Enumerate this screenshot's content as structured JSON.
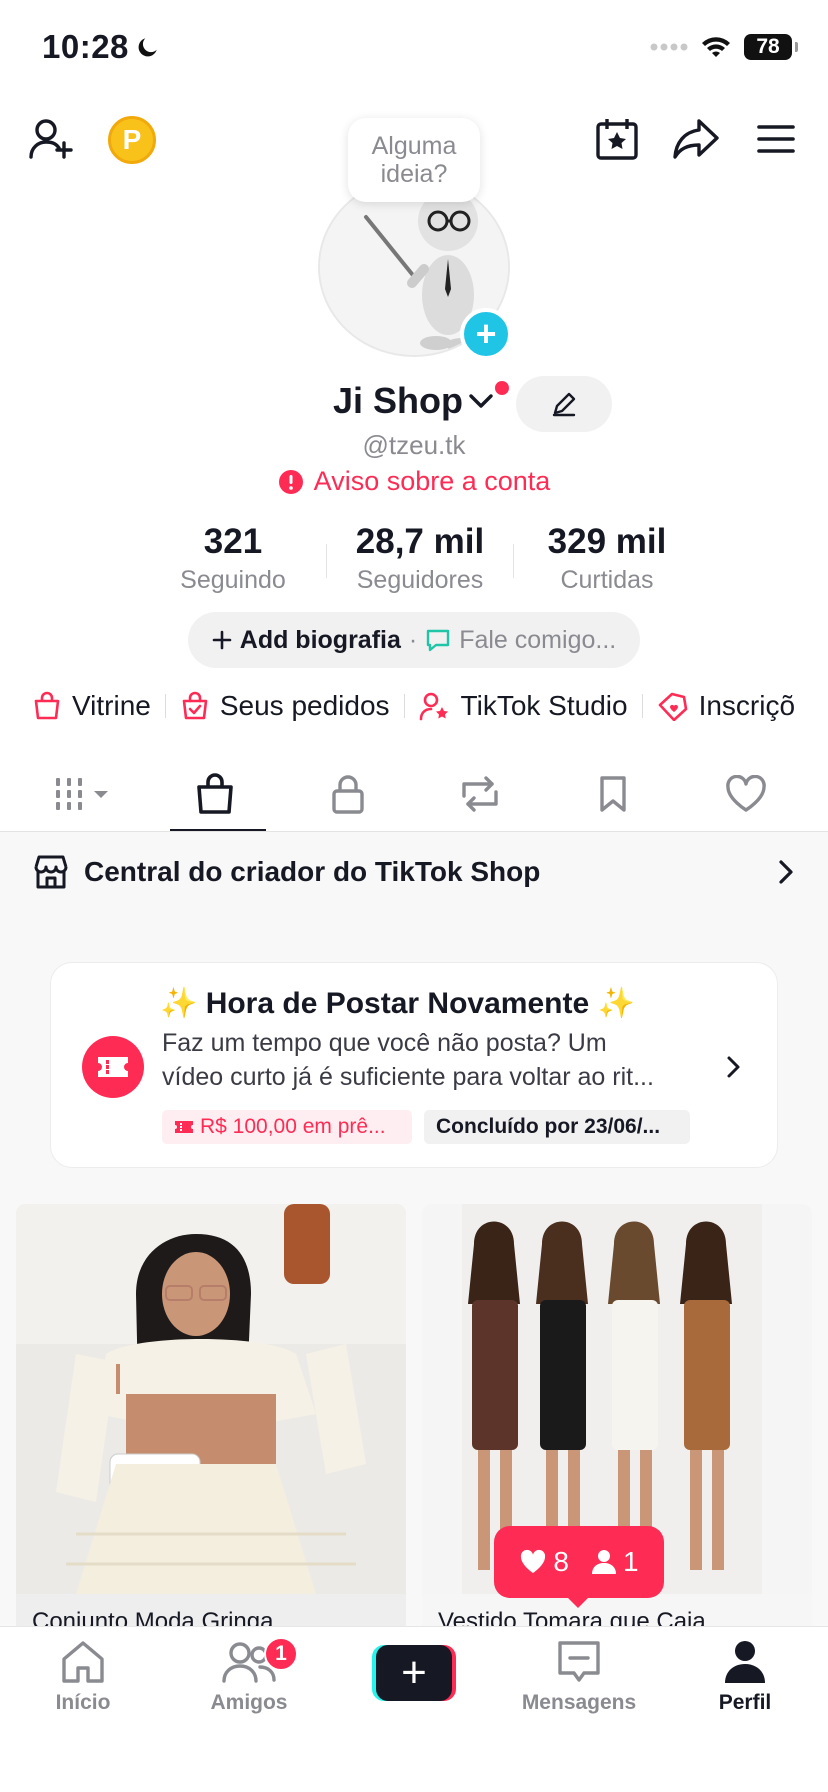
{
  "status_bar": {
    "time": "10:28",
    "battery": "78"
  },
  "profile": {
    "bubble_line1": "Alguma",
    "bubble_line2": "ideia?",
    "name": "Ji Shop",
    "username": "@tzeu.tk",
    "account_warning": "Aviso sobre a conta"
  },
  "stats": [
    {
      "value": "321",
      "label": "Seguindo"
    },
    {
      "value": "28,7 mil",
      "label": "Seguidores"
    },
    {
      "value": "329 mil",
      "label": "Curtidas"
    }
  ],
  "bio": {
    "add_label": "Add biografia",
    "separator": "·",
    "message_placeholder": "Fale comigo..."
  },
  "quick_links": [
    {
      "label": "Vitrine",
      "icon": "shopping-bag-icon"
    },
    {
      "label": "Seus pedidos",
      "icon": "order-bag-check-icon"
    },
    {
      "label": "TikTok Studio",
      "icon": "person-star-icon"
    },
    {
      "label": "Inscriçõ",
      "icon": "tag-heart-icon"
    }
  ],
  "tabs": [
    {
      "name": "grid",
      "active": false
    },
    {
      "name": "shop",
      "active": true
    },
    {
      "name": "private",
      "active": false
    },
    {
      "name": "reposts",
      "active": false
    },
    {
      "name": "saved",
      "active": false
    },
    {
      "name": "liked",
      "active": false
    }
  ],
  "creator_center": {
    "label": "Central do criador do TikTok Shop"
  },
  "promo_card": {
    "title": "✨ Hora de Postar Novamente ✨",
    "desc_line1": "Faz um tempo que você não posta? Um",
    "desc_line2": "vídeo curto já é suficiente para voltar ao rit...",
    "reward": "R$ 100,00 em prê...",
    "deadline": "Concluído por 23/06/..."
  },
  "products": [
    {
      "title": "Conjunto Moda Gringa"
    },
    {
      "title": "Vestido Tomara que Caia"
    }
  ],
  "notification": {
    "likes": "8",
    "followers": "1"
  },
  "bottom_nav": {
    "home": "Início",
    "friends": "Amigos",
    "friends_badge": "1",
    "messages": "Mensagens",
    "profile": "Perfil"
  },
  "colors": {
    "accent": "#fe2c55",
    "cyan": "#25f4ee",
    "text": "#161823",
    "muted": "#8a8b91"
  }
}
